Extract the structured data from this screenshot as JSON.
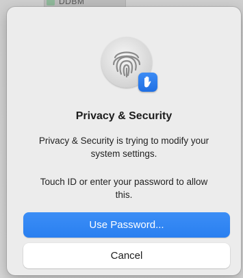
{
  "background": {
    "tab_label": "DDBM"
  },
  "dialog": {
    "icon": {
      "main": "fingerprint-icon",
      "badge": "raised-hand-icon"
    },
    "title": "Privacy & Security",
    "message_line1": "Privacy & Security is trying to modify your system settings.",
    "message_line2": "Touch ID or enter your password to allow this.",
    "primary_button": "Use Password...",
    "secondary_button": "Cancel"
  },
  "colors": {
    "accent": "#2a7ff0",
    "dialog_bg": "#ececec"
  }
}
